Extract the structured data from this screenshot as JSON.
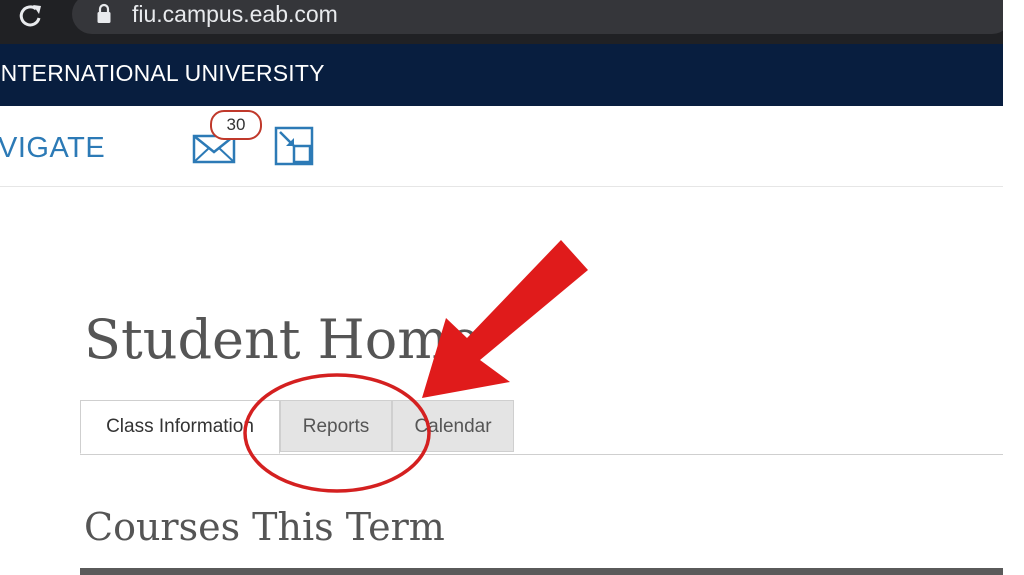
{
  "browser": {
    "url": "fiu.campus.eab.com"
  },
  "banner": {
    "university_name": "INTERNATIONAL UNIVERSITY"
  },
  "nav": {
    "menu_label": "VIGATE",
    "mail_count": "30"
  },
  "page": {
    "title": "Student Home",
    "section_title": "Courses This Term"
  },
  "tabs": [
    {
      "label": "Class Information",
      "active": true
    },
    {
      "label": "Reports",
      "active": false
    },
    {
      "label": "Calendar",
      "active": false
    }
  ],
  "colors": {
    "banner": "#081e3f",
    "link_blue": "#2c7ab6",
    "annotation_red": "#e01b1b"
  }
}
